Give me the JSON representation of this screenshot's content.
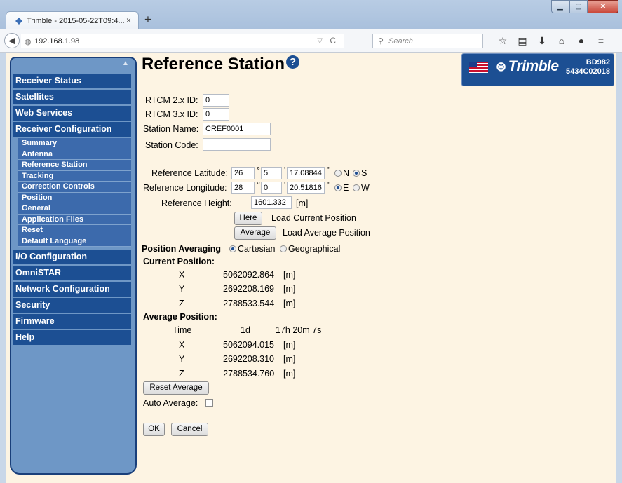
{
  "browser": {
    "tab_title": "Trimble - 2015-05-22T09:4...",
    "tab_close": "×",
    "new_tab": "+",
    "url": "192.168.1.98",
    "search_placeholder": "Search",
    "toolbar_icons": [
      "star-icon",
      "bookmarks-icon",
      "download-icon",
      "home-icon",
      "chat-icon",
      "menu-icon"
    ]
  },
  "sidebar": {
    "top_items": [
      {
        "label": "Receiver Status"
      },
      {
        "label": "Satellites"
      },
      {
        "label": "Web Services"
      },
      {
        "label": "Receiver Configuration"
      }
    ],
    "sub_items": [
      {
        "label": "Summary"
      },
      {
        "label": "Antenna"
      },
      {
        "label": "Reference Station"
      },
      {
        "label": "Tracking"
      },
      {
        "label": "Correction Controls"
      },
      {
        "label": "Position"
      },
      {
        "label": "General"
      },
      {
        "label": "Application Files"
      },
      {
        "label": "Reset"
      },
      {
        "label": "Default Language"
      }
    ],
    "bottom_items": [
      {
        "label": "I/O Configuration"
      },
      {
        "label": "OmniSTAR"
      },
      {
        "label": "Network Configuration"
      },
      {
        "label": "Security"
      },
      {
        "label": "Firmware"
      },
      {
        "label": "Help"
      }
    ]
  },
  "header": {
    "title": "Reference Station",
    "help_glyph": "?"
  },
  "brand": {
    "name": "Trimble",
    "model": "BD982",
    "serial": "5434C02018"
  },
  "form": {
    "rtcm2_label": "RTCM 2.x ID:",
    "rtcm2_value": "0",
    "rtcm3_label": "RTCM 3.x ID:",
    "rtcm3_value": "0",
    "station_name_label": "Station Name:",
    "station_name_value": "CREF0001",
    "station_code_label": "Station Code:",
    "station_code_value": "",
    "lat_label": "Reference Latitude:",
    "lat_deg": "26",
    "lat_min": "5",
    "lat_sec": "17.08844",
    "lat_n": "N",
    "lat_s": "S",
    "lon_label": "Reference Longitude:",
    "lon_deg": "28",
    "lon_min": "0",
    "lon_sec": "20.51816",
    "lon_e": "E",
    "lon_w": "W",
    "deg_sym": "°",
    "min_sym": "'",
    "sec_sym": "\"",
    "height_label": "Reference Height:",
    "height_value": "1601.332",
    "height_unit": "[m]",
    "here_button": "Here",
    "here_desc": "Load Current Position",
    "average_button": "Average",
    "average_desc": "Load Average Position",
    "pos_avg_label": "Position Averaging",
    "cartesian": "Cartesian",
    "geographical": "Geographical",
    "current_pos_label": "Current Position:",
    "current": [
      {
        "axis": "X",
        "value": "5062092.864",
        "unit": "[m]"
      },
      {
        "axis": "Y",
        "value": "2692208.169",
        "unit": "[m]"
      },
      {
        "axis": "Z",
        "value": "-2788533.544",
        "unit": "[m]"
      }
    ],
    "avg_pos_label": "Average Position:",
    "time_label": "Time",
    "time_days": "1d",
    "time_hms": "17h 20m 7s",
    "average": [
      {
        "axis": "X",
        "value": "5062094.015",
        "unit": "[m]"
      },
      {
        "axis": "Y",
        "value": "2692208.310",
        "unit": "[m]"
      },
      {
        "axis": "Z",
        "value": "-2788534.760",
        "unit": "[m]"
      }
    ],
    "reset_average_button": "Reset Average",
    "auto_average_label": "Auto Average:",
    "ok_button": "OK",
    "cancel_button": "Cancel"
  }
}
